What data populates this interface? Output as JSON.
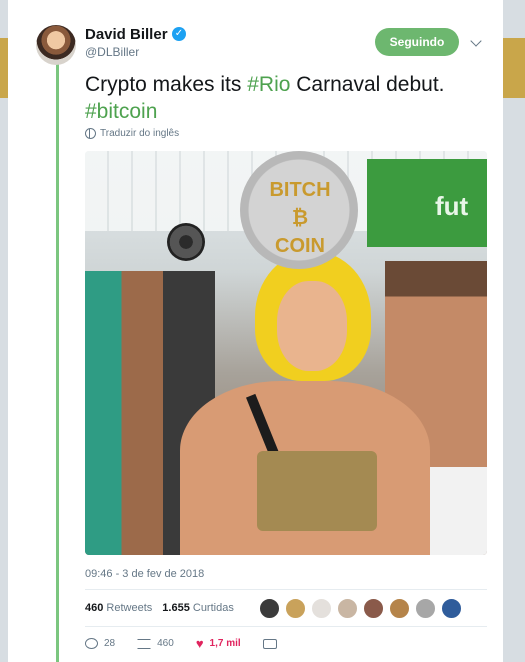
{
  "user": {
    "name": "David Biller",
    "handle": "@DLBiller"
  },
  "follow_button": {
    "label": "Seguindo"
  },
  "tweet": {
    "text_before": "Crypto makes its ",
    "hashtag_1": "#Rio",
    "text_after": " Carnaval debut.",
    "hashtag_2": "#bitcoin",
    "translate_link": "Traduzir do inglês",
    "image_text": [
      "BITCH",
      "COIN"
    ],
    "banner_text": "fut",
    "timestamp": "09:46 - 3 de fev de 2018"
  },
  "stats": {
    "retweets_count": "460",
    "retweets_label": "Retweets",
    "likes_count": "1.655",
    "likes_label": "Curtidas"
  },
  "likers": {
    "count": 8,
    "colors": [
      "#3b3b3b",
      "#c9a25b",
      "#e4e0dc",
      "#c9b6a3",
      "#8a5a4a",
      "#b5844a",
      "#a7a7a7",
      "#2f5c9b"
    ]
  },
  "actions": {
    "replies": "28",
    "retweets": "460",
    "likes": "1,7 mil"
  },
  "colors": {
    "accent_green": "#6db76f",
    "hashtag_green": "#4ea24f",
    "like_red": "#e0245e",
    "verified_blue": "#1da1f2"
  }
}
